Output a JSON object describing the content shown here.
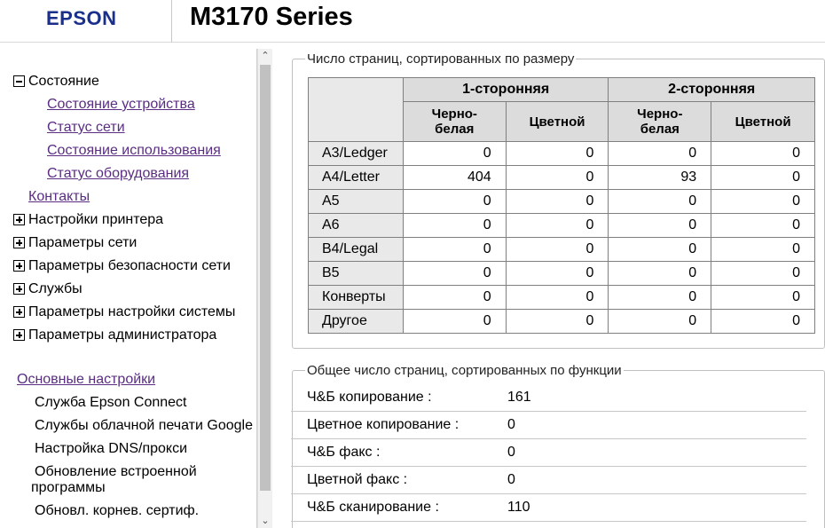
{
  "header": {
    "brand": "EPSON",
    "model": "M3170 Series"
  },
  "sidebar": {
    "status_group": "Состояние",
    "status_items": [
      "Состояние устройства",
      "Статус сети",
      "Состояние использования",
      "Статус оборудования"
    ],
    "contacts": "Контакты",
    "groups": [
      "Настройки принтера",
      "Параметры сети",
      "Параметры безопасности сети",
      "Службы",
      "Параметры настройки системы",
      "Параметры администратора"
    ],
    "basic_settings": "Основные настройки",
    "basic_items": [
      "Служба Epson Connect",
      "Службы облачной печати Google",
      "Настройка DNS/прокси",
      "Обновление встроенной",
      "программы",
      "Обновл. корнев. сертиф."
    ]
  },
  "size_section": {
    "title": "Число страниц, сортированных по размеру",
    "col_groups": [
      "1-сторонняя",
      "2-сторонняя"
    ],
    "sub_bw_line1": "Черно-",
    "sub_bw_line2": "белая",
    "sub_color": "Цветной",
    "rows": [
      {
        "size": "A3/Ledger",
        "values": [
          "0",
          "0",
          "0",
          "0"
        ]
      },
      {
        "size": "A4/Letter",
        "values": [
          "404",
          "0",
          "93",
          "0"
        ]
      },
      {
        "size": "A5",
        "values": [
          "0",
          "0",
          "0",
          "0"
        ]
      },
      {
        "size": "A6",
        "values": [
          "0",
          "0",
          "0",
          "0"
        ]
      },
      {
        "size": "B4/Legal",
        "values": [
          "0",
          "0",
          "0",
          "0"
        ]
      },
      {
        "size": "B5",
        "values": [
          "0",
          "0",
          "0",
          "0"
        ]
      },
      {
        "size": "Конверты",
        "values": [
          "0",
          "0",
          "0",
          "0"
        ]
      },
      {
        "size": "Другое",
        "values": [
          "0",
          "0",
          "0",
          "0"
        ]
      }
    ]
  },
  "function_section": {
    "title": "Общее число страниц, сортированных по функции",
    "rows": [
      {
        "label": "Ч&Б копирование :",
        "value": "161"
      },
      {
        "label": "Цветное копирование :",
        "value": "0"
      },
      {
        "label": "Ч&Б факс :",
        "value": "0"
      },
      {
        "label": "Цветной факс :",
        "value": "0"
      },
      {
        "label": "Ч&Б сканирование :",
        "value": "110"
      }
    ]
  },
  "icons": {
    "collapse": "minus-box-icon",
    "expand": "plus-box-icon",
    "scroll_up": "chevron-up-icon",
    "scroll_down": "chevron-down-icon"
  },
  "colors": {
    "brand": "#1a2f8a",
    "link": "#5a2d82",
    "table_header": "#dcdcdc"
  }
}
